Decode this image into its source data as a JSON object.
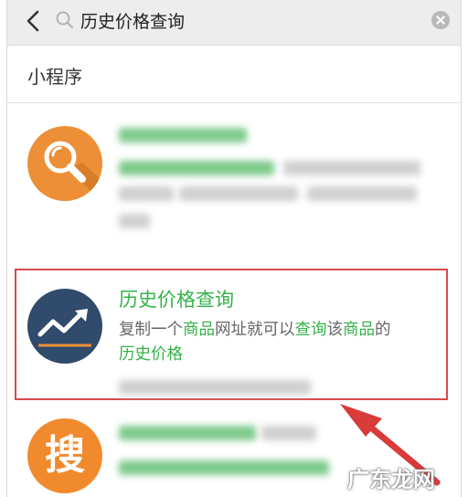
{
  "search": {
    "value": "历史价格查询"
  },
  "section": {
    "title": "小程序"
  },
  "result2": {
    "title": "历史价格查询",
    "desc_parts": [
      "复制一个",
      "商品",
      "网址就可以",
      "查询",
      "该",
      "商品",
      "的",
      "历史价格"
    ]
  },
  "result3": {
    "icon_glyph": "搜"
  },
  "watermark": {
    "text": "广东龙网"
  },
  "colors": {
    "accent_green": "#36b24a",
    "highlight_red": "#d64a4a",
    "arrow_red": "#d93a3a",
    "orange": "#ec8f36",
    "navy": "#304b6b"
  }
}
